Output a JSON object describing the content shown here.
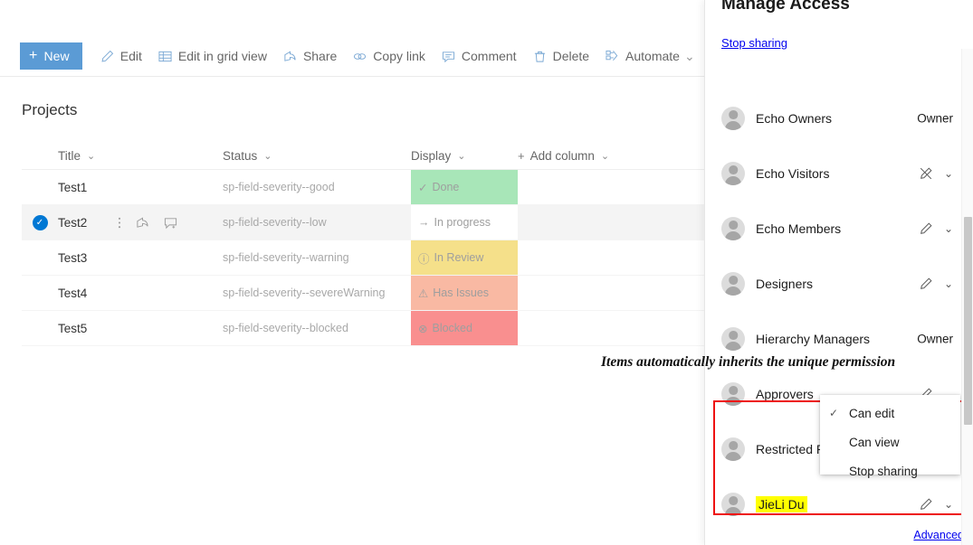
{
  "command_bar": {
    "new_button": {
      "label": "New",
      "plus": "+"
    },
    "items": [
      {
        "label": "Edit",
        "icon": "pencil-icon",
        "caret": false
      },
      {
        "label": "Edit in grid view",
        "icon": "grid-icon",
        "caret": false
      },
      {
        "label": "Share",
        "icon": "share-icon",
        "caret": false
      },
      {
        "label": "Copy link",
        "icon": "link-icon",
        "caret": false
      },
      {
        "label": "Comment",
        "icon": "comment-icon",
        "caret": false
      },
      {
        "label": "Delete",
        "icon": "trash-icon",
        "caret": false
      },
      {
        "label": "Automate",
        "icon": "automate-icon",
        "caret": true
      }
    ],
    "overflow": "···"
  },
  "list": {
    "title": "Projects",
    "columns": [
      {
        "label": "Title",
        "caret": "⌄"
      },
      {
        "label": "Status",
        "caret": "⌄"
      },
      {
        "label": "Display",
        "caret": "⌄"
      },
      {
        "label": "Add column",
        "caret": "⌄",
        "plus": "+"
      }
    ],
    "rows": [
      {
        "title": "Test1",
        "status": "sp-field-severity--good",
        "display": "Done",
        "display_glyph": "✓",
        "display_bg": "#a8e6b8",
        "selected": false
      },
      {
        "title": "Test2",
        "status": "sp-field-severity--low",
        "display": "In progress",
        "display_glyph": "→",
        "display_bg": "#ffffff",
        "selected": true
      },
      {
        "title": "Test3",
        "status": "sp-field-severity--warning",
        "display": "In Review",
        "display_glyph": "ⓘ",
        "display_bg": "#f5e08a",
        "selected": false
      },
      {
        "title": "Test4",
        "status": "sp-field-severity--severeWarning",
        "display": "Has Issues",
        "display_glyph": "⚠",
        "display_bg": "#f9b9a3",
        "selected": false
      },
      {
        "title": "Test5",
        "status": "sp-field-severity--blocked",
        "display": "Blocked",
        "display_glyph": "⊗",
        "display_bg": "#f98f8f",
        "selected": false
      }
    ],
    "row_action_icons": [
      "more-vertical-icon",
      "share-icon",
      "comment-add-icon"
    ]
  },
  "annotation": {
    "text": "Items automatically inherits the unique permission"
  },
  "panel": {
    "title": "Manage Access",
    "stop_sharing_link": "Stop sharing",
    "advanced_link": "Advanced",
    "people": [
      {
        "name": "Echo Owners",
        "right_text": "Owner",
        "icon": null,
        "caret": false,
        "highlight": false
      },
      {
        "name": "Echo Visitors",
        "right_text": null,
        "icon": "pencil-blocked-icon",
        "caret": true,
        "highlight": false
      },
      {
        "name": "Echo Members",
        "right_text": null,
        "icon": "pencil-icon",
        "caret": true,
        "highlight": false
      },
      {
        "name": "Designers",
        "right_text": null,
        "icon": "pencil-icon",
        "caret": true,
        "highlight": false
      },
      {
        "name": "Hierarchy Managers",
        "right_text": "Owner",
        "icon": null,
        "caret": false,
        "highlight": false
      },
      {
        "name": "Approvers",
        "right_text": null,
        "icon": "pencil-icon",
        "caret": true,
        "highlight": false
      },
      {
        "name": "Restricted Re",
        "right_text": null,
        "icon": null,
        "caret": false,
        "highlight": false
      },
      {
        "name": "JieLi Du",
        "right_text": null,
        "icon": "pencil-icon",
        "caret": true,
        "highlight": true
      }
    ],
    "context_menu": {
      "items": [
        {
          "label": "Can edit",
          "checked": true
        },
        {
          "label": "Can view",
          "checked": false
        },
        {
          "label": "Stop sharing",
          "checked": false
        }
      ]
    }
  },
  "colors": {
    "accent_blue": "#5b9bd5",
    "checkbox_blue": "#0078d4",
    "highlight_yellow": "#ffff00",
    "callout_red": "#ee1111",
    "link_blue": "#0000ee"
  }
}
